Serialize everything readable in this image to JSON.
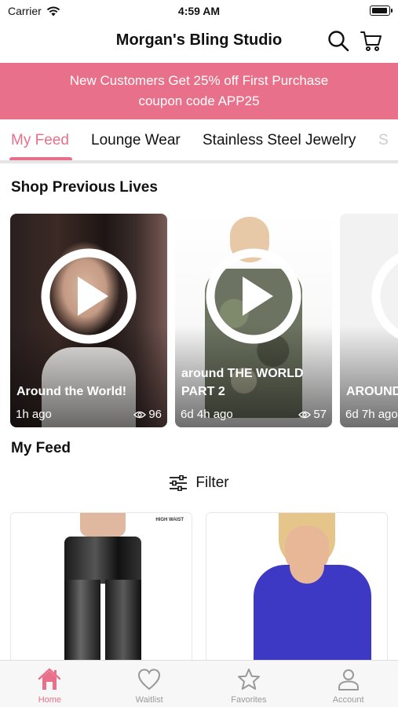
{
  "status_bar": {
    "carrier": "Carrier",
    "time": "4:59 AM"
  },
  "header": {
    "title": "Morgan's Bling Studio"
  },
  "promo": {
    "line1": "New Customers Get 25% off First Purchase",
    "line2": "coupon code APP25"
  },
  "tabs": [
    {
      "label": "My Feed"
    },
    {
      "label": "Lounge Wear"
    },
    {
      "label": "Stainless Steel Jewelry"
    },
    {
      "label": "S"
    }
  ],
  "sections": {
    "lives_title": "Shop Previous Lives",
    "feed_title": "My Feed"
  },
  "lives": [
    {
      "title": "Around the World!",
      "time": "1h ago",
      "views": "96"
    },
    {
      "title": "around THE WORLD PART 2",
      "time": "6d 4h ago",
      "views": "57"
    },
    {
      "title": "AROUND THE WORLD",
      "time": "6d 7h ago",
      "views": ""
    }
  ],
  "filter": {
    "label": "Filter"
  },
  "products": [
    {
      "badge": "HIGH WAIST"
    },
    {
      "badge": ""
    }
  ],
  "bottom_nav": [
    {
      "label": "Home"
    },
    {
      "label": "Waitlist"
    },
    {
      "label": "Favorites"
    },
    {
      "label": "Account"
    }
  ],
  "colors": {
    "accent": "#E8708A",
    "promo_bg": "#E8708A",
    "inactive": "#999999"
  }
}
